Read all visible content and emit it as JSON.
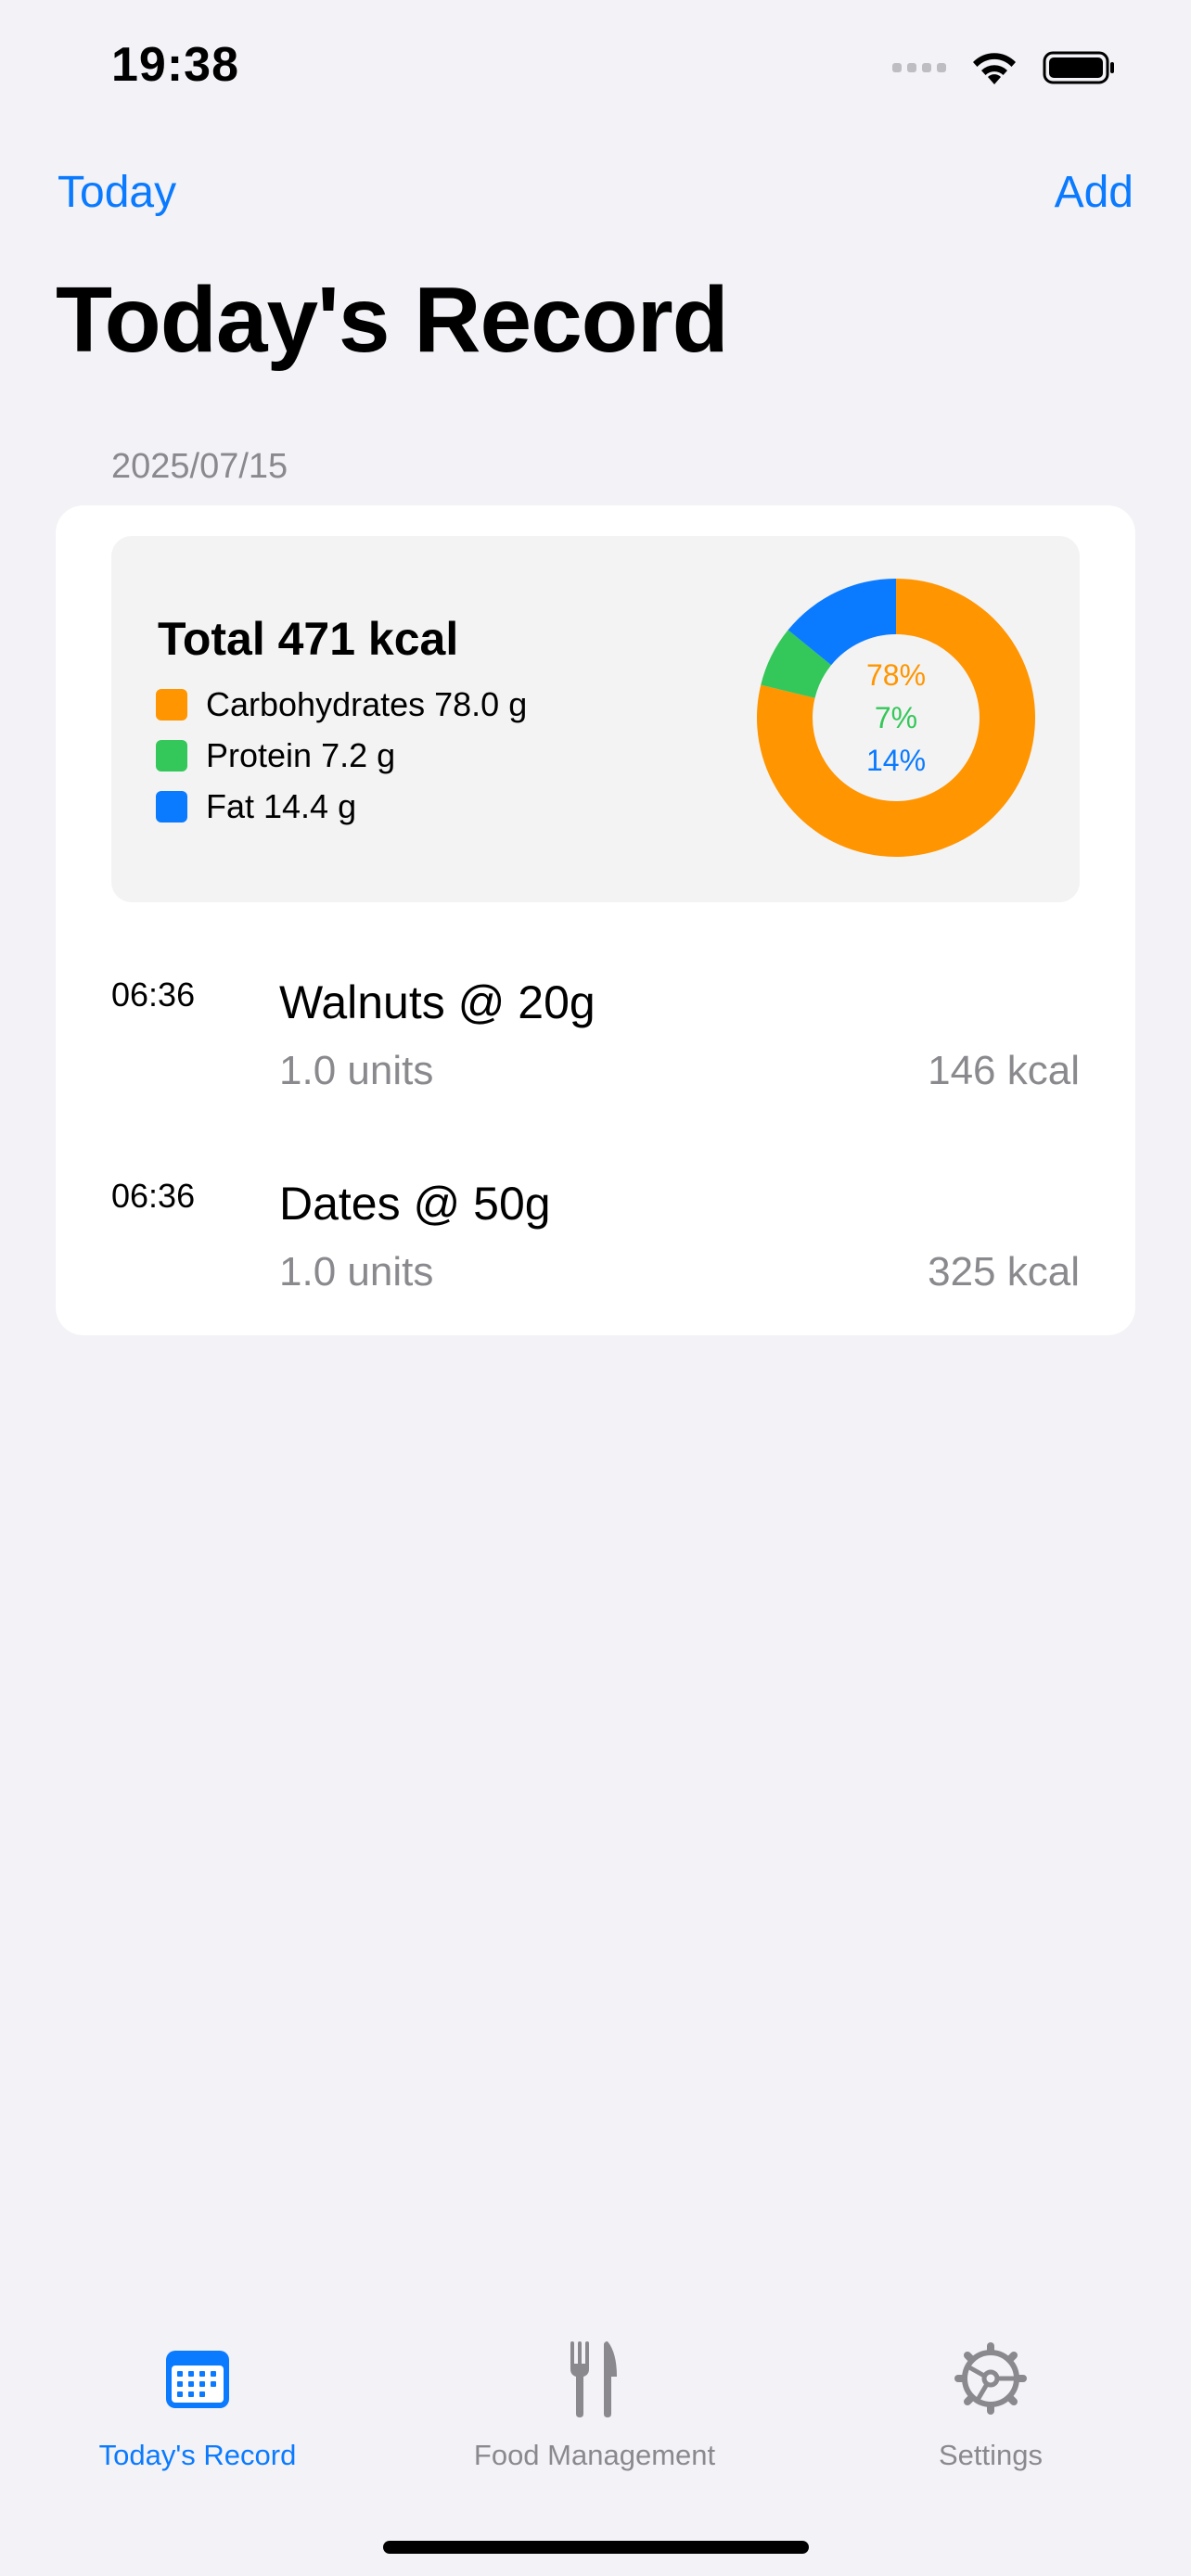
{
  "status_bar": {
    "time": "19:38"
  },
  "nav": {
    "left_label": "Today",
    "right_label": "Add",
    "title": "Today's Record"
  },
  "date": "2025/07/15",
  "summary": {
    "total": "Total 471 kcal",
    "legend": [
      {
        "label": "Carbohydrates 78.0 g",
        "color": "#FF9500"
      },
      {
        "label": "Protein 7.2 g",
        "color": "#34C759"
      },
      {
        "label": "Fat 14.4 g",
        "color": "#0A7AFF"
      }
    ],
    "chart_data": {
      "type": "pie",
      "categories": [
        "Carbohydrates",
        "Protein",
        "Fat"
      ],
      "values": [
        78,
        7,
        14
      ],
      "labels": [
        "78%",
        "7%",
        "14%"
      ],
      "colors": [
        "#FF9500",
        "#34C759",
        "#0A7AFF"
      ]
    }
  },
  "entries": [
    {
      "time": "06:36",
      "name": "Walnuts @ 20g",
      "units": "1.0 units",
      "kcal": "146 kcal"
    },
    {
      "time": "06:36",
      "name": "Dates @ 50g",
      "units": "1.0 units",
      "kcal": "325 kcal"
    }
  ],
  "tabs": [
    {
      "label": "Today's Record",
      "icon": "calendar-icon",
      "active": true
    },
    {
      "label": "Food Management",
      "icon": "fork-knife-icon",
      "active": false
    },
    {
      "label": "Settings",
      "icon": "gear-icon",
      "active": false
    }
  ]
}
